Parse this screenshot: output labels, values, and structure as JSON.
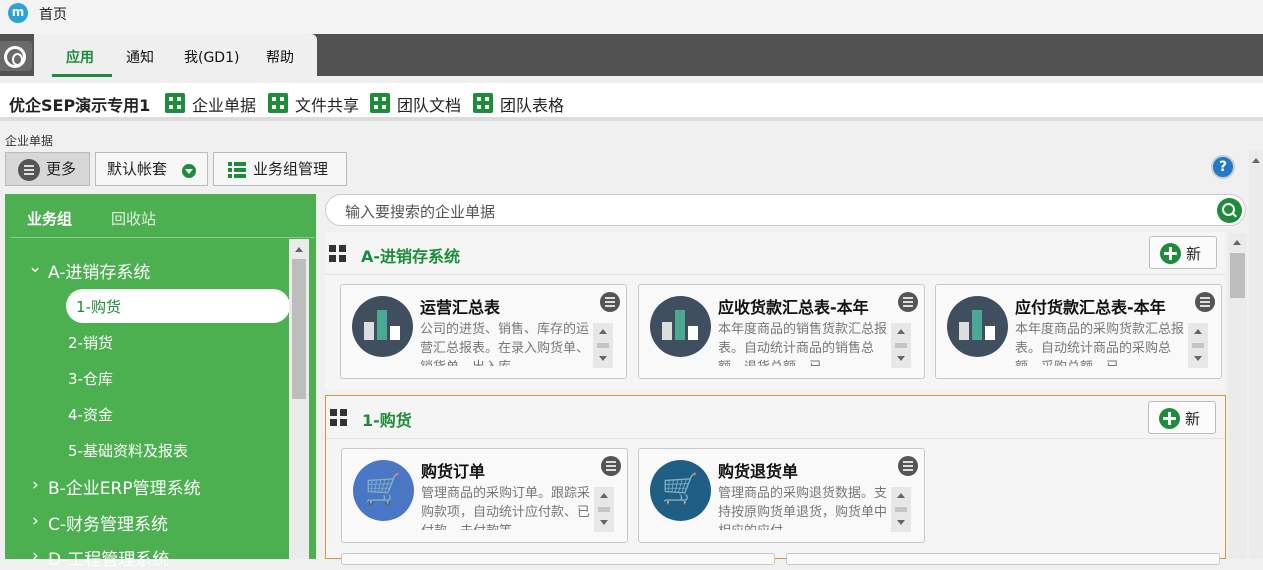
{
  "window": {
    "logo_letter": "m",
    "title": "首页"
  },
  "main_tabs": [
    {
      "label": "应用",
      "active": true
    },
    {
      "label": "通知",
      "active": false
    },
    {
      "label": "我(GD1)",
      "active": false
    },
    {
      "label": "帮助",
      "active": false
    }
  ],
  "linkbar": {
    "company": "优企SEP演示专用1",
    "links": [
      "企业单据",
      "文件共享",
      "团队文档",
      "团队表格"
    ]
  },
  "section_label": "企业单据",
  "toolbar": {
    "more": "更多",
    "account": "默认帐套",
    "group_manage": "业务组管理",
    "help": "?"
  },
  "sidebar": {
    "tabs": [
      "业务组",
      "回收站"
    ],
    "tree": [
      {
        "label": "A-进销存系统",
        "expanded": true,
        "children": [
          "1-购货",
          "2-销货",
          "3-仓库",
          "4-资金",
          "5-基础资料及报表"
        ],
        "selected": "1-购货"
      },
      {
        "label": "B-企业ERP管理系统",
        "expanded": false
      },
      {
        "label": "C-财务管理系统",
        "expanded": false
      },
      {
        "label": "D-工程管理系统",
        "expanded": false
      }
    ]
  },
  "search": {
    "placeholder": "输入要搜索的企业单据"
  },
  "groups": [
    {
      "title": "A-进销存系统",
      "new_label": "新",
      "cards": [
        {
          "title": "运营汇总表",
          "desc": "公司的进货、销售、库存的运营汇总报表。在录入购货单、销货单、出入库",
          "icon": "bar-chart-icon"
        },
        {
          "title": "应收货款汇总表-本年",
          "desc": "本年度商品的销售货款汇总报表。自动统计商品的销售总额、退货总额、已",
          "icon": "bar-chart-icon"
        },
        {
          "title": "应付货款汇总表-本年",
          "desc": "本年度商品的采购货款汇总报表。自动统计商品的采购总额、采购总额、已",
          "icon": "bar-chart-icon"
        }
      ]
    },
    {
      "title": "1-购货",
      "new_label": "新",
      "cards": [
        {
          "title": "购货订单",
          "desc": "管理商品的采购订单。跟踪采购款项，自动统计应付款、已付款、未付款等",
          "icon": "cart-add-icon"
        },
        {
          "title": "购货退货单",
          "desc": "管理商品的采购退货数据。支持按原购货单退货，购货单中相应的应付",
          "icon": "cart-return-icon"
        }
      ]
    }
  ],
  "colors": {
    "brand_green": "#1e8c3a",
    "sidebar_green": "#4caf50",
    "accent_border": "#d49a3a"
  }
}
